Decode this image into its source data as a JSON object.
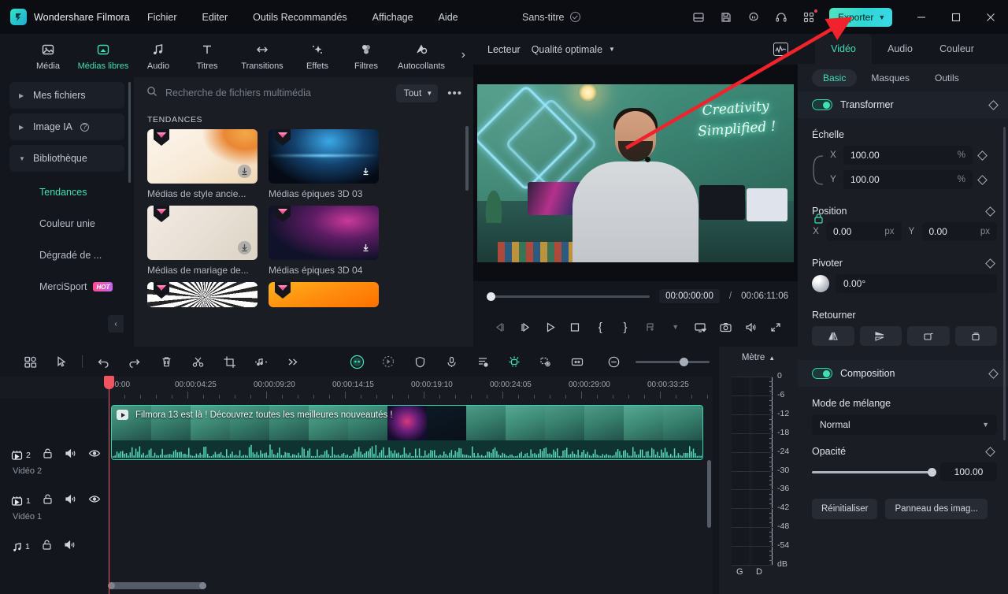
{
  "app": {
    "brand": "Wondershare Filmora",
    "document_title": "Sans-titre",
    "menus": [
      "Fichier",
      "Editer",
      "Outils Recommandés",
      "Affichage",
      "Aide"
    ],
    "export_label": "Exporter",
    "accent_color": "#3fe0b8",
    "export_gradient_start": "#4fe3c0",
    "export_gradient_end": "#3bd8e6",
    "window_controls": [
      "minimize",
      "maximize",
      "close"
    ],
    "title_icons": [
      "save-layout-icon",
      "save-project-icon",
      "cloud-backup-icon",
      "headset-support-icon",
      "apps-grid-icon"
    ]
  },
  "tool_tabs": [
    {
      "label": "Média",
      "icon": "media-icon",
      "active": false
    },
    {
      "label": "Médias libres",
      "icon": "stock-media-icon",
      "active": true
    },
    {
      "label": "Audio",
      "icon": "audio-note-icon",
      "active": false
    },
    {
      "label": "Titres",
      "icon": "titles-T-icon",
      "active": false
    },
    {
      "label": "Transitions",
      "icon": "transitions-arrows-icon",
      "active": false
    },
    {
      "label": "Effets",
      "icon": "effects-sparkle-icon",
      "active": false
    },
    {
      "label": "Filtres",
      "icon": "filters-circles-icon",
      "active": false
    },
    {
      "label": "Autocollants",
      "icon": "stickers-icon",
      "active": false
    }
  ],
  "sidebar": {
    "groups": [
      {
        "label": "Mes fichiers",
        "expanded": false,
        "caret": "▶"
      },
      {
        "label": "Image IA",
        "expanded": false,
        "caret": "▶",
        "help": "?"
      },
      {
        "label": "Bibliothèque",
        "expanded": true,
        "caret": "▼"
      }
    ],
    "items": [
      {
        "label": "Tendances",
        "active": true,
        "badge": ""
      },
      {
        "label": "Couleur unie",
        "active": false,
        "badge": ""
      },
      {
        "label": "Dégradé de ...",
        "active": false,
        "badge": ""
      },
      {
        "label": "MerciSport",
        "active": false,
        "badge": "HOT"
      }
    ]
  },
  "browser": {
    "search_placeholder": "Recherche de fichiers multimédia",
    "search_value": "",
    "filter_label": "Tout",
    "more_label": "•••",
    "section_title": "TENDANCES",
    "items": [
      {
        "label": "Médias de style ancie...",
        "download": "circle",
        "premium": true
      },
      {
        "label": "Médias épiques 3D 03",
        "download": "plain",
        "premium": true
      },
      {
        "label": "Médias de mariage de...",
        "download": "circle",
        "premium": true
      },
      {
        "label": "Médias épiques 3D 04",
        "download": "plain",
        "premium": true
      },
      {
        "label": "",
        "download": "",
        "premium": true
      },
      {
        "label": "",
        "download": "",
        "premium": true
      }
    ]
  },
  "preview": {
    "player_label": "Lecteur",
    "quality_label": "Qualité optimale",
    "scope_icon": "waveform-scope-icon",
    "current_time": "00:00:00:00",
    "separator": "/",
    "total_time": "00:06:11:06",
    "overlay_text_line1": "Creativity",
    "overlay_text_line2": "Simplified !",
    "controls": [
      {
        "name": "previous-frame-button",
        "glyph": "◁|"
      },
      {
        "name": "step-forward-button",
        "glyph": "|▷"
      },
      {
        "name": "play-button",
        "glyph": "▷"
      },
      {
        "name": "stop-button",
        "glyph": "□"
      },
      {
        "name": "mark-in-button",
        "glyph": "{"
      },
      {
        "name": "mark-out-button",
        "glyph": "}"
      },
      {
        "name": "add-marker-button",
        "glyph": "⎅"
      },
      {
        "name": "marker-dropdown-button",
        "glyph": "⌄"
      },
      {
        "name": "display-mode-button",
        "glyph": "🖵"
      },
      {
        "name": "snapshot-button",
        "glyph": "◎"
      },
      {
        "name": "volume-button",
        "glyph": "🔊"
      },
      {
        "name": "fullscreen-button",
        "glyph": "⤢"
      }
    ]
  },
  "properties": {
    "tabs": [
      {
        "label": "Vidéo",
        "active": true
      },
      {
        "label": "Audio",
        "active": false
      },
      {
        "label": "Couleur",
        "active": false
      }
    ],
    "subtabs": [
      {
        "label": "Basic",
        "active": true
      },
      {
        "label": "Masques",
        "active": false
      },
      {
        "label": "Outils",
        "active": false
      }
    ],
    "transform": {
      "title": "Transformer",
      "enabled": true,
      "scale_label": "Échelle",
      "scale_x_axis": "X",
      "scale_x": "100.00",
      "scale_x_unit": "%",
      "scale_y_axis": "Y",
      "scale_y": "100.00",
      "scale_y_unit": "%",
      "position_label": "Position",
      "pos_x_axis": "X",
      "pos_x": "0.00",
      "pos_x_unit": "px",
      "pos_y_axis": "Y",
      "pos_y": "0.00",
      "pos_y_unit": "px",
      "rotate_label": "Pivoter",
      "rotate_value": "0.00°",
      "flip_label": "Retourner",
      "flip_buttons": [
        "flip-horizontal-icon",
        "flip-vertical-icon",
        "rotate-right-icon",
        "rotate-left-icon"
      ]
    },
    "composition": {
      "title": "Composition",
      "enabled": true,
      "blend_label": "Mode de mélange",
      "blend_value": "Normal",
      "opacity_label": "Opacité",
      "opacity_value": "100.00",
      "opacity_percent": 100
    },
    "footer_buttons": [
      {
        "label": "Réinitialiser",
        "name": "reset-button"
      },
      {
        "label": "Panneau des imag...",
        "name": "keyframe-panel-button"
      }
    ]
  },
  "timeline": {
    "toolbar_icons": [
      {
        "name": "template-grid-icon"
      },
      {
        "name": "select-tool-icon"
      },
      {
        "name": "undo-icon"
      },
      {
        "name": "redo-icon"
      },
      {
        "name": "delete-icon"
      },
      {
        "name": "split-scissors-icon"
      },
      {
        "name": "crop-icon"
      },
      {
        "name": "audio-detach-icon"
      },
      {
        "name": "more-chevrons-icon"
      },
      {
        "name": "ai-smart-icon"
      },
      {
        "name": "speed-icon"
      },
      {
        "name": "color-shield-icon"
      },
      {
        "name": "voiceover-mic-icon"
      },
      {
        "name": "auto-beat-icon"
      },
      {
        "name": "ai-effects-icon"
      },
      {
        "name": "green-screen-icon"
      },
      {
        "name": "fit-timeline-icon"
      },
      {
        "name": "zoom-out-icon"
      },
      {
        "name": "zoom-in-icon"
      }
    ],
    "header_icons": [
      {
        "name": "add-track-icon"
      },
      {
        "name": "link-tracks-icon"
      }
    ],
    "ruler_labels": [
      "00:00",
      "00:00:04:25",
      "00:00:09:20",
      "00:00:14:15",
      "00:00:19:10",
      "00:00:24:05",
      "00:00:29:00",
      "00:00:33:25"
    ],
    "tracks": [
      {
        "name": "Vidéo 2",
        "number": "2",
        "kind": "video",
        "icons": [
          "unlock-icon",
          "mute-icon",
          "eye-icon"
        ]
      },
      {
        "name": "Vidéo 1",
        "number": "1",
        "kind": "video",
        "icons": [
          "unlock-icon",
          "mute-icon",
          "eye-icon"
        ]
      },
      {
        "name": "",
        "number": "1",
        "kind": "audio",
        "icons": [
          "unlock-icon",
          "mute-icon"
        ]
      }
    ],
    "clip": {
      "title": "Filmora 13 est là ! Découvrez toutes les meilleures nouveautés  !",
      "selected": true
    }
  },
  "meter": {
    "title": "Mètre",
    "caret": "▲",
    "scale": [
      "0",
      "-6",
      "-12",
      "-18",
      "-24",
      "-30",
      "-36",
      "-42",
      "-48",
      "-54",
      "dB"
    ],
    "channels": [
      "G",
      "D"
    ]
  }
}
